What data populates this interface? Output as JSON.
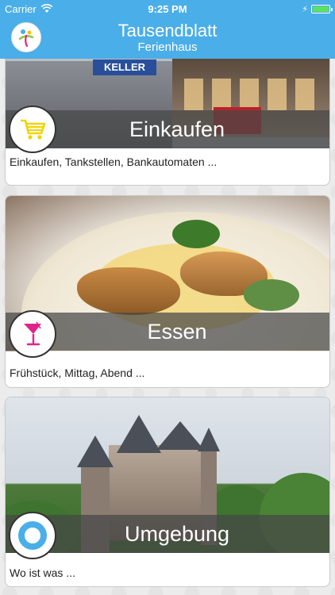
{
  "status_bar": {
    "carrier": "Carrier",
    "time": "9:25 PM",
    "battery_level": 1.0,
    "battery_color": "#5fe05f"
  },
  "nav": {
    "title": "Tausendblatt",
    "subtitle": "Ferienhaus",
    "bar_color": "#4aaee8"
  },
  "cards": [
    {
      "title": "Einkaufen",
      "description": "Einkaufen, Tankstellen, Bankautomaten ...",
      "icon": "shopping-cart-icon",
      "icon_color": "#f0d400",
      "photo_sign": "KELLER"
    },
    {
      "title": "Essen",
      "description": "Frühstück, Mittag, Abend ...",
      "icon": "cocktail-glass-icon",
      "icon_color": "#e0258a"
    },
    {
      "title": "Umgebung",
      "description": "Wo ist was ...",
      "icon": "location-ring-icon",
      "icon_color": "#4aaee8"
    }
  ]
}
